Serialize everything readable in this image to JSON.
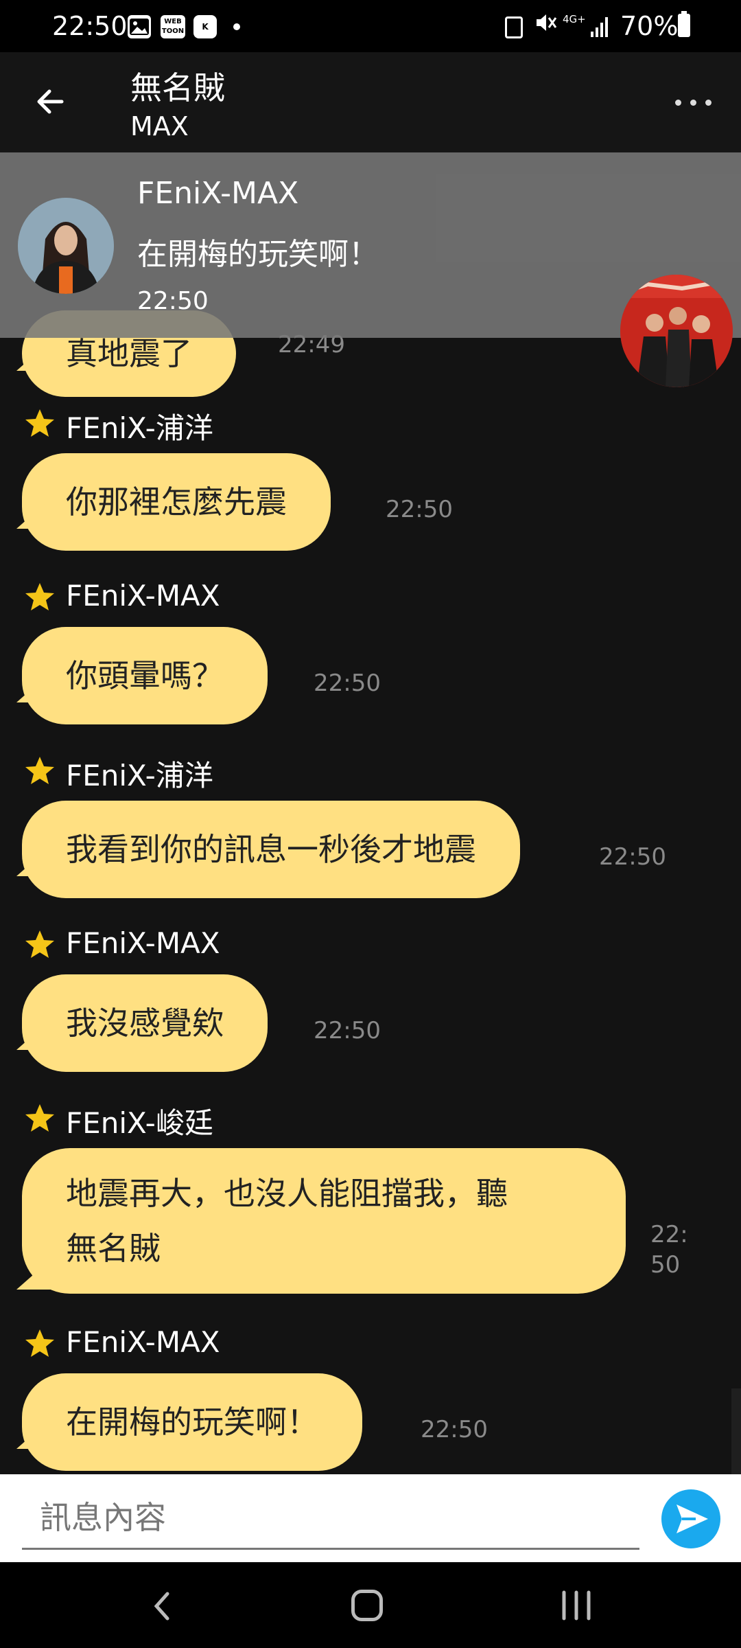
{
  "status_bar": {
    "time": "22:50",
    "battery": "70%",
    "network": "4G+",
    "icons": [
      "gallery-icon",
      "webtoon-icon",
      "k-app-icon",
      "dot-icon",
      "lock-icon",
      "mute-icon",
      "signal-icon",
      "battery-icon"
    ]
  },
  "header": {
    "title": "無名賊",
    "subtitle": "MAX",
    "back_icon": "arrow-left-icon",
    "menu_icon": "more-horizontal-icon"
  },
  "notification": {
    "sender": "FEniX-MAX",
    "text": "在開梅的玩笑啊！",
    "time": "22:50"
  },
  "messages": [
    {
      "partial": true,
      "text": "真地震了",
      "time": "22:49"
    },
    {
      "sender": "FEniX-浦洋",
      "text": "你那裡怎麼先震",
      "time": "22:50"
    },
    {
      "sender": "FEniX-MAX",
      "text": "你頭暈嗎？",
      "time": "22:50"
    },
    {
      "sender": "FEniX-浦洋",
      "text": "我看到你的訊息一秒後才地震",
      "time": "22:50"
    },
    {
      "sender": "FEniX-MAX",
      "text": "我沒感覺欸",
      "time": "22:50"
    },
    {
      "sender": "FEniX-峻廷",
      "text_line1": "地震再大，也沒人能阻擋我，聽",
      "text_line2": "無名賊",
      "time_line1": "22:",
      "time_line2": "50"
    },
    {
      "sender": "FEniX-MAX",
      "text": "在開梅的玩笑啊！",
      "time": "22:50"
    }
  ],
  "input": {
    "placeholder": "訊息內容",
    "value": ""
  },
  "colors": {
    "bubble": "#ffe082",
    "background": "#131313",
    "star": "#f5c518",
    "send": "#1aa9ee"
  }
}
